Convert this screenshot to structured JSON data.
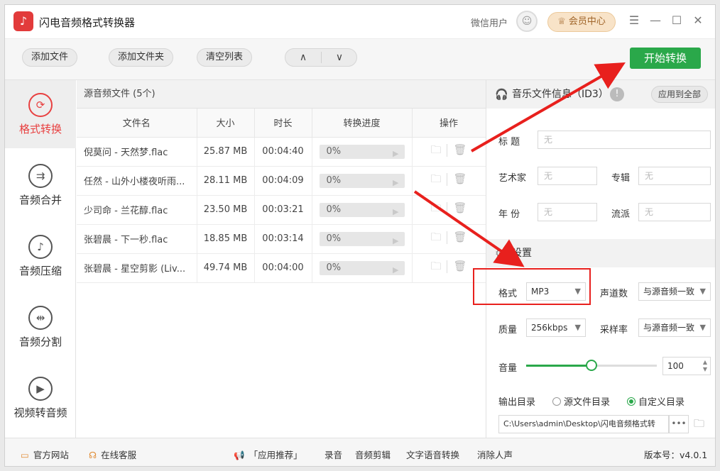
{
  "app": {
    "title": "闪电音频格式转换器",
    "logo_glyph": "♪"
  },
  "header": {
    "user_name": "微信用户",
    "member_label": "会员中心",
    "member_glyph": "♕",
    "avatar_glyph": "☺"
  },
  "window_controls": {
    "menu": "☰",
    "minimize": "—",
    "maximize": "☐",
    "close": "✕"
  },
  "toolbar": {
    "add_file": "添加文件",
    "add_folder": "添加文件夹",
    "clear_list": "清空列表",
    "move_up": "∧",
    "move_down": "∨",
    "start": "开始转换"
  },
  "sidebar": {
    "items": [
      {
        "label": "格式转换",
        "icon": "convert-icon",
        "glyph": "⟳",
        "active": true
      },
      {
        "label": "音频合并",
        "icon": "merge-icon",
        "glyph": "⇉",
        "active": false
      },
      {
        "label": "音频压缩",
        "icon": "compress-icon",
        "glyph": "♪",
        "active": false
      },
      {
        "label": "音频分割",
        "icon": "split-icon",
        "glyph": "⇹",
        "active": false
      },
      {
        "label": "视频转音频",
        "icon": "video-icon",
        "glyph": "▶",
        "active": false
      }
    ]
  },
  "filelist": {
    "header": "源音频文件 (5个)",
    "columns": [
      "文件名",
      "大小",
      "时长",
      "转换进度",
      "操作"
    ],
    "rows": [
      {
        "name": "倪莫问 - 天然梦.flac",
        "size": "25.87 MB",
        "duration": "00:04:40",
        "progress": "0%"
      },
      {
        "name": "任然 - 山外小楼夜听雨...",
        "size": "28.11 MB",
        "duration": "00:04:09",
        "progress": "0%"
      },
      {
        "name": "少司命 - 兰花醇.flac",
        "size": "23.50 MB",
        "duration": "00:03:21",
        "progress": "0%"
      },
      {
        "name": "张碧晨 - 下一秒.flac",
        "size": "18.85 MB",
        "duration": "00:03:14",
        "progress": "0%"
      },
      {
        "name": "张碧晨 - 星空剪影 (Liv...",
        "size": "49.74 MB",
        "duration": "00:04:00",
        "progress": "0%"
      }
    ]
  },
  "music_info": {
    "title": "音乐文件信息（ID3）",
    "apply_all": "应用到全部",
    "fields": {
      "title_label": "标    题",
      "artist_label": "艺术家",
      "album_label": "专辑",
      "year_label": "年    份",
      "genre_label": "流派",
      "empty": "无"
    }
  },
  "settings": {
    "title": "设置",
    "format_label": "格式",
    "format_value": "MP3",
    "channels_label": "声道数",
    "channels_value": "与源音频一致",
    "quality_label": "质量",
    "quality_value": "256kbps",
    "samplerate_label": "采样率",
    "samplerate_value": "与源音频一致",
    "volume_label": "音量",
    "volume_value": "100",
    "volume_level": 0.5,
    "output_label": "输出目录",
    "radio_source": "源文件目录",
    "radio_custom": "自定义目录",
    "output_path": "C:\\Users\\admin\\Desktop\\闪电音频格式转",
    "path_more": "•••"
  },
  "footer": {
    "website": "官方网站",
    "service": "在线客服",
    "recommend": "「应用推荐」",
    "record": "录音",
    "edit": "音频剪辑",
    "tts": "文字语音转换",
    "vocal": "消除人声",
    "version": "版本号：v4.0.1"
  },
  "colors": {
    "accent_green": "#2aa84a",
    "accent_red": "#e84040",
    "annotation_red": "#e8201d"
  }
}
